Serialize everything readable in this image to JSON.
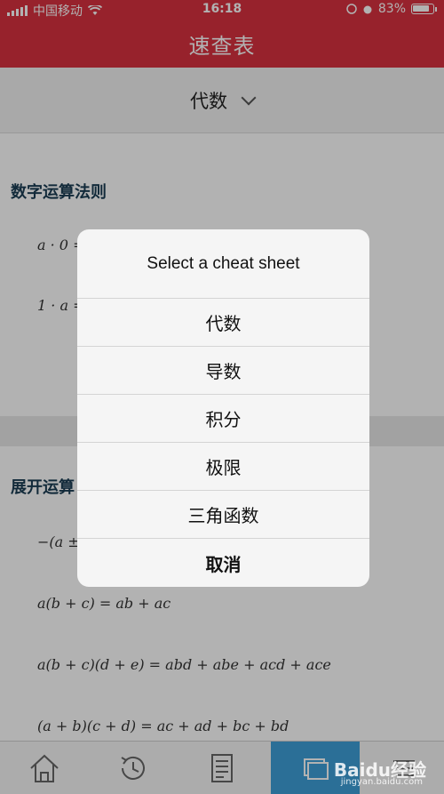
{
  "status": {
    "carrier": "中国移动",
    "time": "16:18",
    "battery": "83%"
  },
  "nav": {
    "title": "速查表"
  },
  "selector": {
    "value": "代数"
  },
  "sections": [
    {
      "title": "数字运算法则",
      "formulas": [
        "a · 0 =",
        "1 · a ="
      ]
    },
    {
      "title": "展开运算",
      "formulas": [
        "−(a ±",
        "a(b + c) = ab + ac",
        "a(b + c)(d + e) = abd + abe + acd + ace",
        "(a + b)(c + d) = ac + ad + bc + bd"
      ]
    }
  ],
  "sheet": {
    "title": "Select a cheat sheet",
    "options": [
      "代数",
      "导数",
      "积分",
      "极限",
      "三角函数"
    ],
    "cancel": "取消"
  },
  "tabbar": {
    "icons": [
      "home-icon",
      "history-icon",
      "document-icon",
      "cards-icon",
      "menu-icon"
    ],
    "active_index": 3
  },
  "watermark": {
    "text": "Baidu经验",
    "sub": "jingyan.baidu.com"
  }
}
